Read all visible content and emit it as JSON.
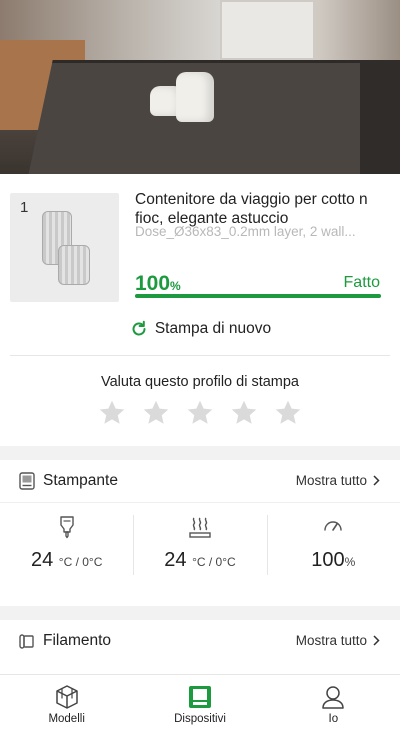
{
  "job": {
    "plate_number": "1",
    "title": "Contenitore da viaggio per cotto n fioc, elegante astuccio",
    "subtitle": "Dose_Ø36x83_0.2mm layer, 2 wall...",
    "progress_value": "100",
    "progress_unit": "%",
    "progress_fraction": 1.0,
    "status": "Fatto",
    "reprint_label": "Stampa di nuovo",
    "rate_label": "Valuta questo profilo di stampa",
    "rating": 0,
    "max_rating": 5
  },
  "printer": {
    "title": "Stampante",
    "more_label": "Mostra tutto",
    "nozzle_value": "24",
    "nozzle_unit": "°C / 0°C",
    "bed_value": "24",
    "bed_unit": "°C / 0°C",
    "fan_value": "100",
    "fan_unit": "%"
  },
  "filament": {
    "title": "Filamento",
    "more_label": "Mostra tutto"
  },
  "nav": {
    "items": [
      {
        "label": "Modelli",
        "icon": "cube-icon"
      },
      {
        "label": "Dispositivi",
        "icon": "printer-icon"
      },
      {
        "label": "Io",
        "icon": "user-icon"
      }
    ],
    "active_index": 1
  },
  "colors": {
    "accent": "#1d9a3f",
    "star": "#dadada",
    "muted_text": "#b8b8b8"
  }
}
